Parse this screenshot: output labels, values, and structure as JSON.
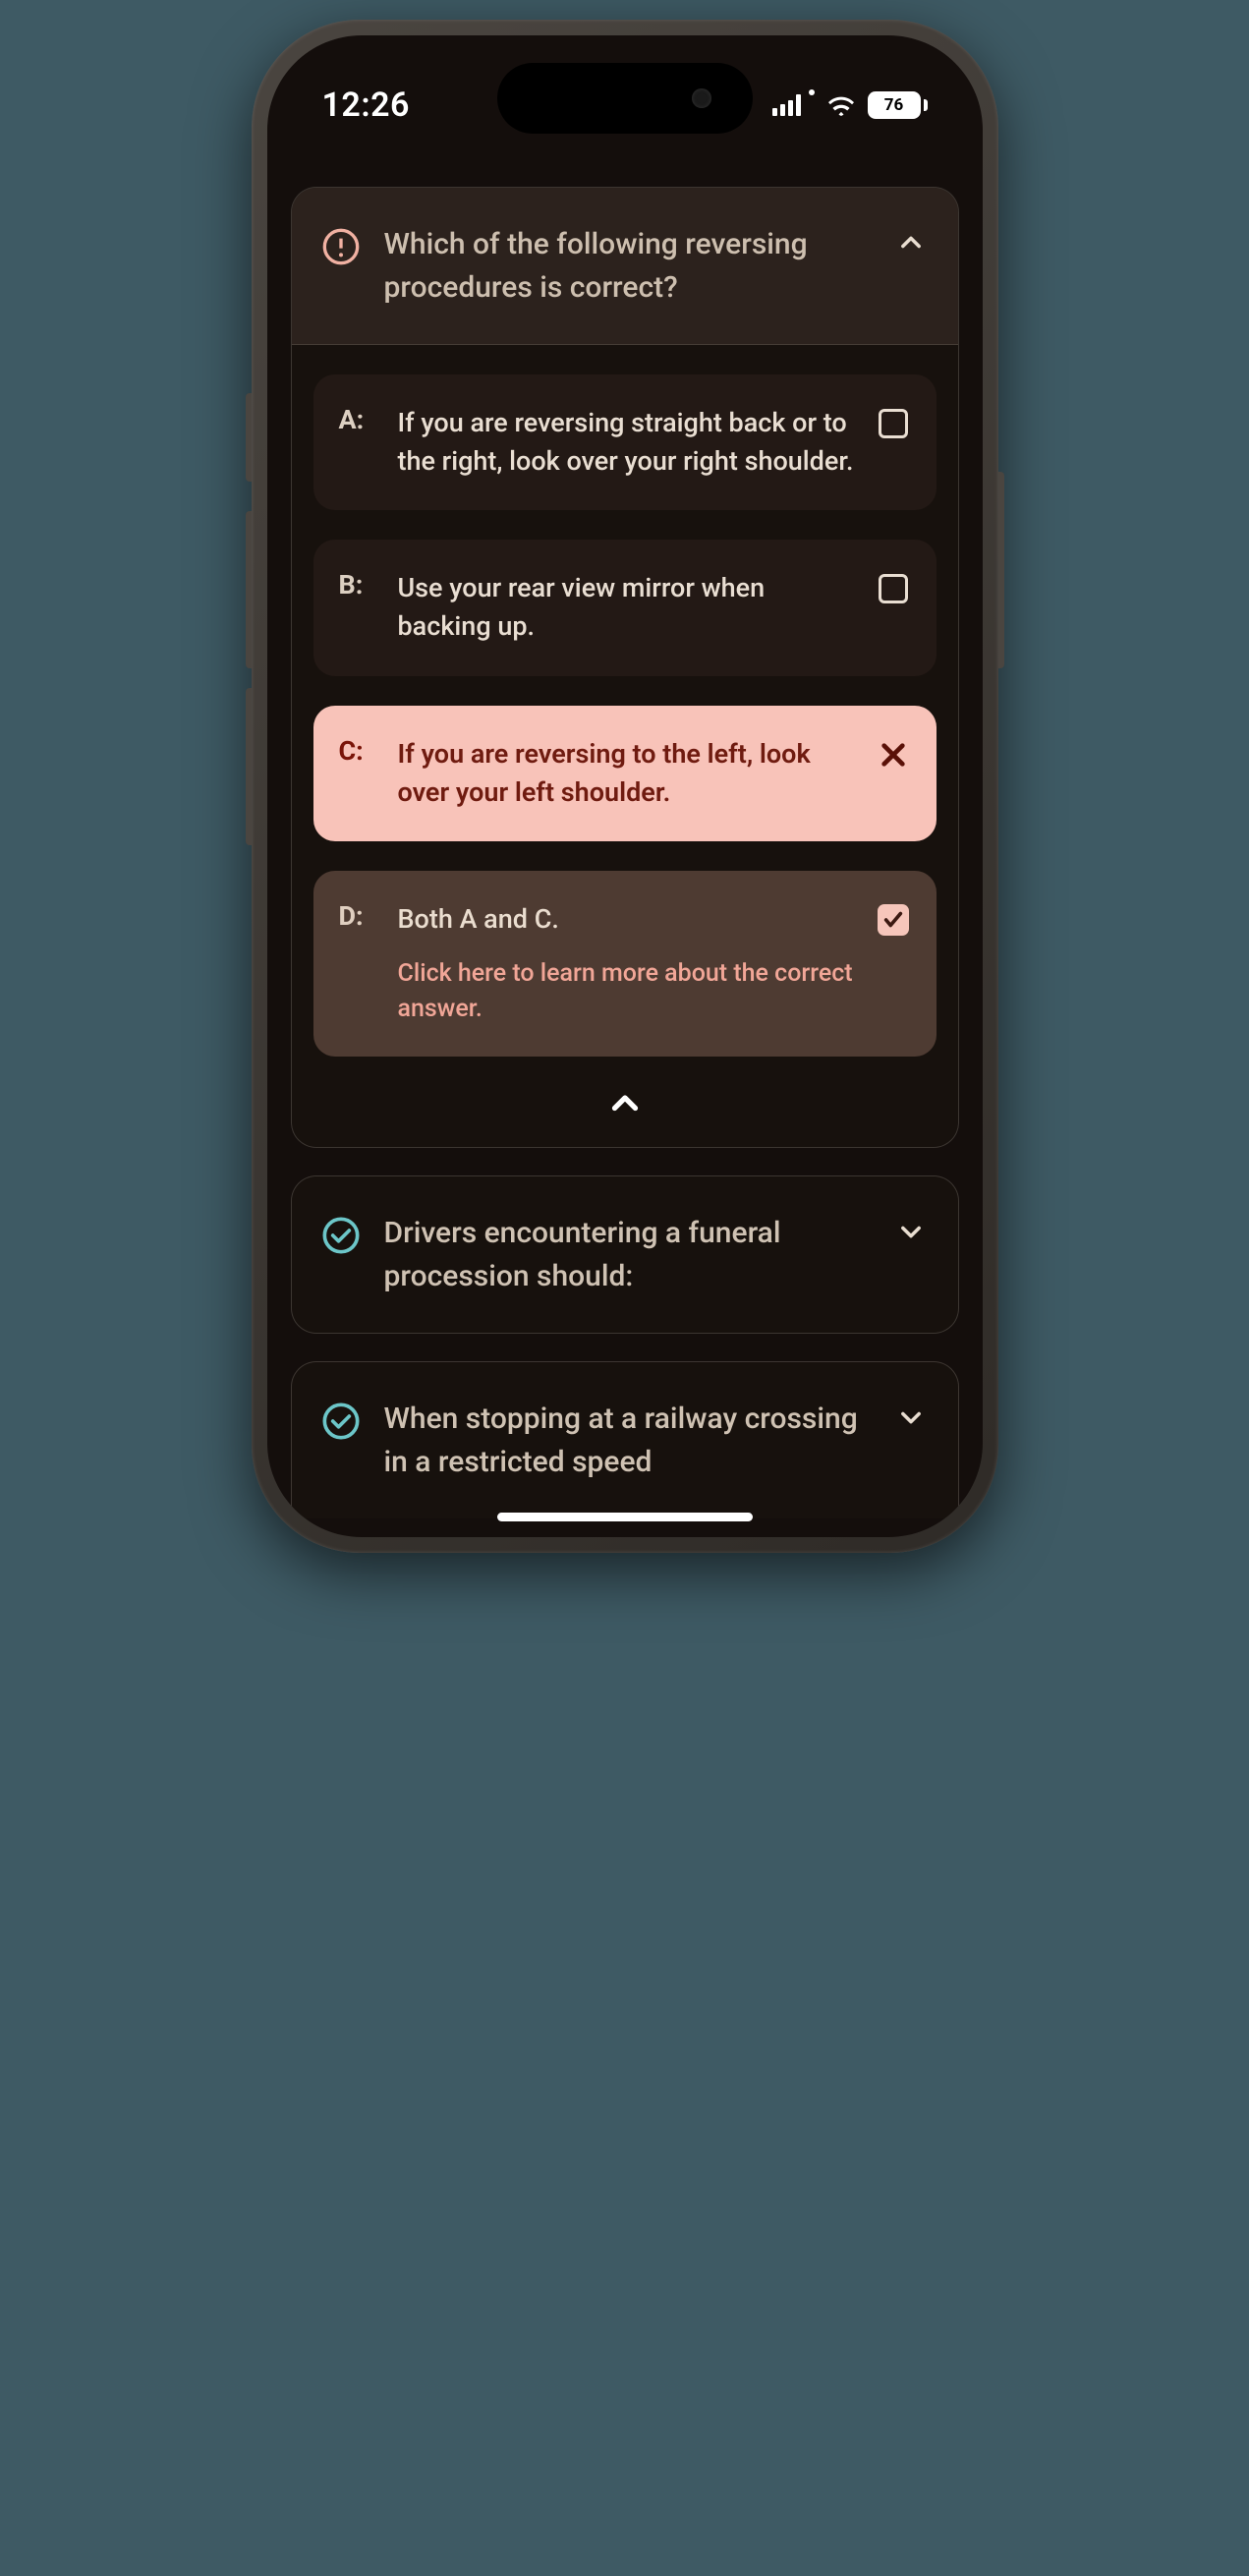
{
  "status_bar": {
    "time": "12:26",
    "battery_pct": "76"
  },
  "questions": [
    {
      "status": "wrong",
      "expanded": true,
      "text": "Which of the following reversing procedures is correct?",
      "answers": [
        {
          "letter": "A:",
          "text": "If you are reversing straight back or to the right, look over your right shoulder.",
          "state": "unchecked"
        },
        {
          "letter": "B:",
          "text": "Use your rear view mirror when backing up.",
          "state": "unchecked"
        },
        {
          "letter": "C:",
          "text": "If you are reversing to the left, look over your left shoulder.",
          "state": "wrong"
        },
        {
          "letter": "D:",
          "text": "Both A and C.",
          "state": "correct",
          "learn_more": "Click here to learn more about the correct answer."
        }
      ]
    },
    {
      "status": "correct",
      "expanded": false,
      "text": "Drivers encountering a funeral procession should:"
    },
    {
      "status": "correct",
      "expanded": false,
      "text": "When stopping at a railway crossing in a restricted speed"
    }
  ]
}
